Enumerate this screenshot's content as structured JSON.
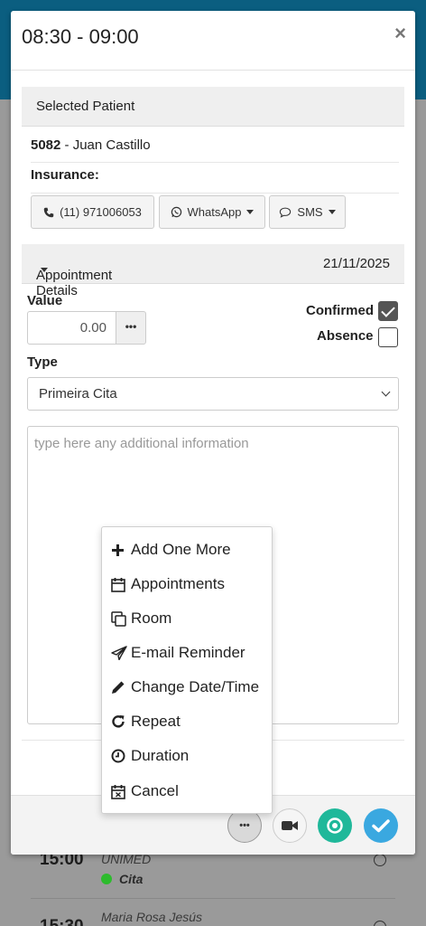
{
  "modal": {
    "title": "08:30 - 09:00",
    "close_symbol": "×"
  },
  "patient_section": {
    "title": "Selected Patient",
    "patient_id": "5082",
    "patient_sep": " - ",
    "patient_name": "Juan Castillo",
    "insurance_label": "Insurance:"
  },
  "contact_buttons": {
    "phone": "(11) 971006053",
    "whatsapp": "WhatsApp",
    "sms": "SMS"
  },
  "details_section": {
    "title": "Appointment Details",
    "date": "21/11/2025"
  },
  "form": {
    "value_label": "Value",
    "value": "0.00",
    "value_dots": "•••",
    "confirmed_label": "Confirmed",
    "confirmed_checked": true,
    "absence_label": "Absence",
    "absence_checked": false,
    "type_label": "Type",
    "type_selected": "Primeira Cita",
    "notes_placeholder": "type here any additional information"
  },
  "menu": {
    "items": [
      {
        "label": "Add One More",
        "icon": "plus-icon"
      },
      {
        "label": "Appointments",
        "icon": "calendar-icon"
      },
      {
        "label": "Room",
        "icon": "copy-icon"
      },
      {
        "label": "E-mail Reminder",
        "icon": "paper-plane-icon"
      },
      {
        "label": "Change Date/Time",
        "icon": "pencil-icon"
      },
      {
        "label": "Repeat",
        "icon": "refresh-icon"
      },
      {
        "label": "Duration",
        "icon": "clock-icon"
      },
      {
        "label": "Cancel",
        "icon": "calendar-x-icon"
      }
    ]
  },
  "footer": {
    "more_label": "•••"
  },
  "background_list": [
    {
      "time": "15:00",
      "name": "UNIMED",
      "sub": "Cita"
    },
    {
      "time": "15:30",
      "name": "Maria Rosa Jesús"
    }
  ],
  "colors": {
    "header_bg": "#0b5e80",
    "teal_button": "#1fb89a",
    "blue_button": "#3aa8e0",
    "status_green": "#2dbb2d"
  }
}
